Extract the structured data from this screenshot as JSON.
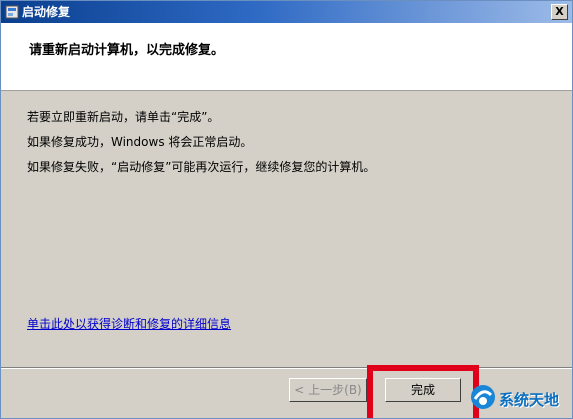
{
  "window": {
    "title": "启动修复",
    "close_label": "X"
  },
  "header": {
    "text": "请重新启动计算机，以完成修复。"
  },
  "content": {
    "lines": [
      "若要立即重新启动，请单击“完成”。",
      "如果修复成功，Windows 将会正常启动。",
      "如果修复失败，“启动修复”可能再次运行，继续修复您的计算机。"
    ],
    "details_link": "单击此处以获得诊断和修复的详细信息"
  },
  "buttons": {
    "back_label": "< 上一步(B)",
    "finish_label": "完成"
  },
  "watermark": {
    "text": "系统天地"
  },
  "colors": {
    "titlebar": "#0a3f8f",
    "highlight": "#e1001a",
    "link": "#0000cc",
    "face": "#d4d0c8"
  }
}
